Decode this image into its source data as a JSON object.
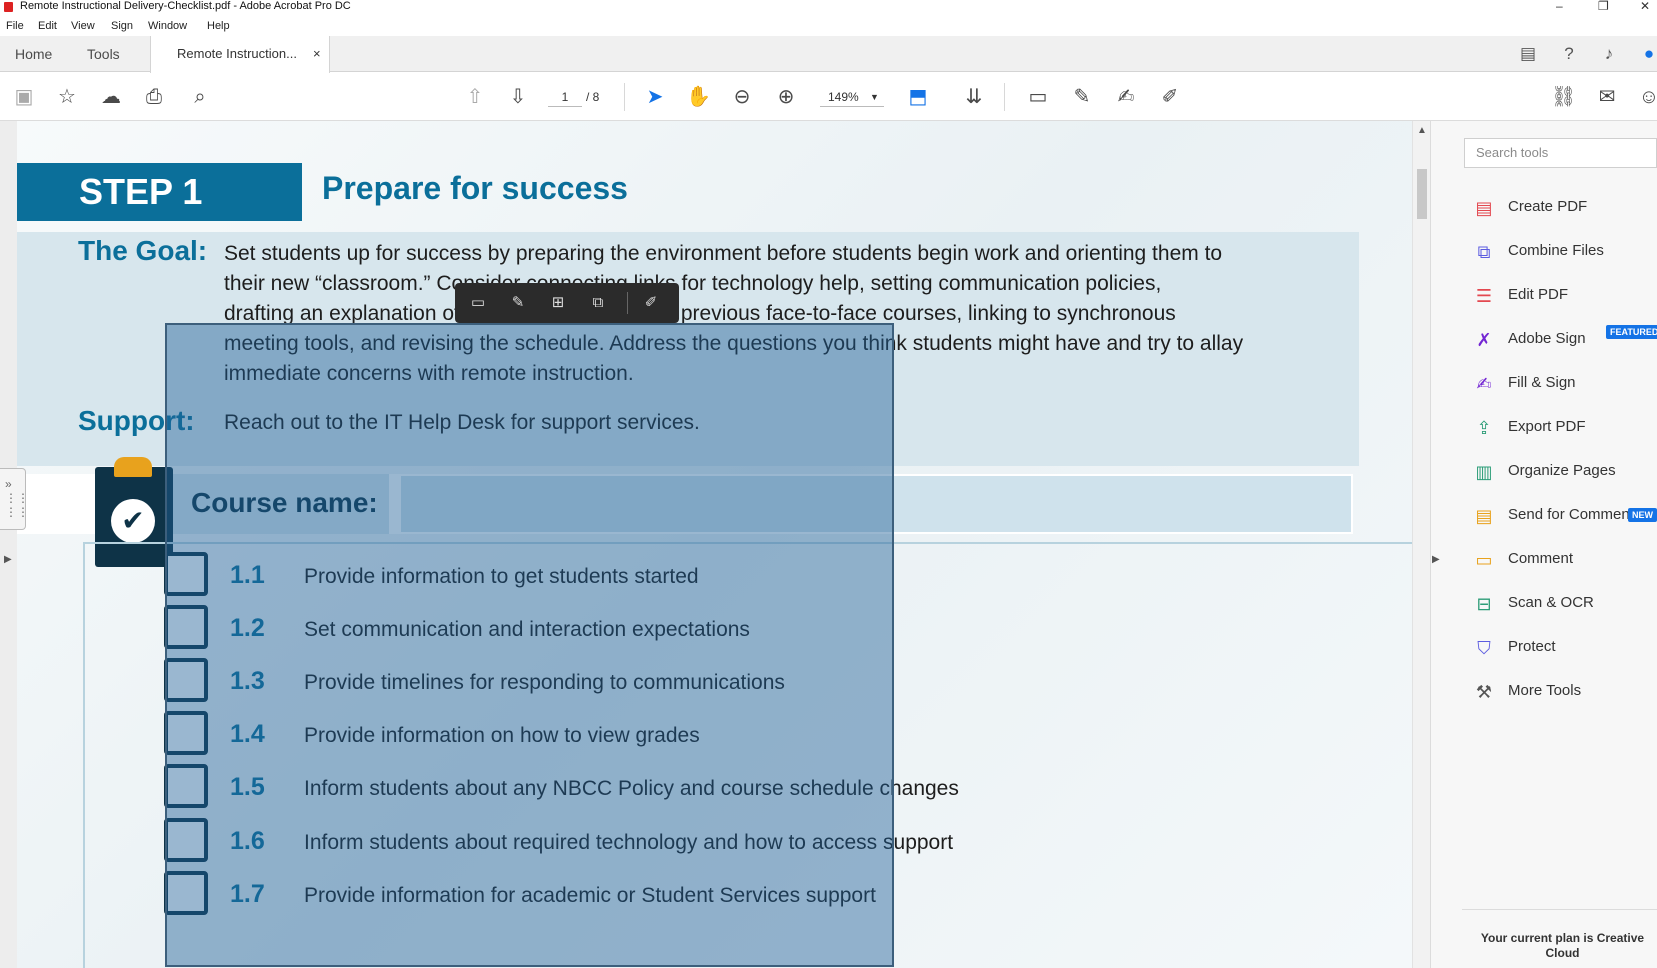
{
  "window": {
    "title": "Remote Instructional Delivery-Checklist.pdf - Adobe Acrobat Pro DC",
    "controls": [
      "minimize-icon",
      "restore-icon",
      "close-icon"
    ]
  },
  "menu": [
    "File",
    "Edit",
    "View",
    "Sign",
    "Window",
    "Help"
  ],
  "tabs": {
    "home": "Home",
    "tools": "Tools",
    "document": "Remote Instruction...",
    "close": "×",
    "right_icons": [
      "chat-icon",
      "help-icon",
      "bell-icon",
      "account-icon"
    ]
  },
  "toolbar": {
    "page_current": "1",
    "page_total": "/ 8",
    "zoom": "149%",
    "left_icons": [
      "save-icon",
      "bookmark-star-icon",
      "upload-icon",
      "print-icon",
      "search-zoom-icon"
    ],
    "nav_icons": [
      "page-up-icon",
      "page-down-icon"
    ],
    "view_icons": [
      "select-arrow-icon",
      "hand-icon",
      "zoom-out-icon",
      "zoom-in-icon"
    ],
    "right_icons": [
      "fit-page-icon",
      "scroll-mode-icon",
      "comment-icon",
      "highlight-icon",
      "sign-icon",
      "edit-icon",
      "link-icon",
      "mail-icon",
      "share-user-icon"
    ]
  },
  "document": {
    "step_label": "STEP 1",
    "step_heading": "Prepare for success",
    "goal_label": "The Goal:",
    "goal_text": [
      "Set students up for success by preparing the environment before students begin work and orienting them to",
      "their new “classroom.” Consider connecting links for technology help, setting communication policies,",
      "drafting an explanation of what’s different than in previous face-to-face courses, linking to synchronous",
      "meeting tools, and revising the schedule.  Address the questions you think students might have and try to allay",
      "immediate concerns with remote instruction."
    ],
    "support_label": "Support:",
    "support_text": "Reach out to the IT Help Desk for support services.",
    "course_label": "Course name:",
    "items": [
      {
        "num": "1.1",
        "text": "Provide information to get students started"
      },
      {
        "num": "1.2",
        "text": "Set communication and interaction expectations"
      },
      {
        "num": "1.3",
        "text": "Provide timelines for responding to communications"
      },
      {
        "num": "1.4",
        "text": "Provide information on how to view grades"
      },
      {
        "num": "1.5",
        "text": "Inform students about any NBCC Policy and course schedule changes"
      },
      {
        "num": "1.6",
        "text": "Inform students about required technology and how to access support"
      },
      {
        "num": "1.7",
        "text": "Provide information for academic or Student Services support"
      }
    ]
  },
  "selection_toolbar": [
    "comment-icon",
    "highlight-pen-icon",
    "stamp-icon",
    "crop-copy-icon",
    "edit-text-icon"
  ],
  "tools_pane": {
    "search_placeholder": "Search tools",
    "items": [
      {
        "label": "Create PDF",
        "icon": "create-pdf-icon",
        "color": "#e34850"
      },
      {
        "label": "Combine Files",
        "icon": "combine-files-icon",
        "color": "#5c5ce0"
      },
      {
        "label": "Edit PDF",
        "icon": "edit-pdf-icon",
        "color": "#e34850"
      },
      {
        "label": "Adobe Sign",
        "icon": "adobe-sign-icon",
        "color": "#7326d3",
        "badge": "FEATURED"
      },
      {
        "label": "Fill & Sign",
        "icon": "fill-sign-icon",
        "color": "#7326d3"
      },
      {
        "label": "Export PDF",
        "icon": "export-pdf-icon",
        "color": "#2d9d78"
      },
      {
        "label": "Organize Pages",
        "icon": "organize-pages-icon",
        "color": "#2d9d78"
      },
      {
        "label": "Send for Comments",
        "icon": "send-comments-icon",
        "color": "#e8a21d",
        "badge": "NEW"
      },
      {
        "label": "Comment",
        "icon": "comment-icon",
        "color": "#e8a21d"
      },
      {
        "label": "Scan & OCR",
        "icon": "scan-ocr-icon",
        "color": "#2d9d78"
      },
      {
        "label": "Protect",
        "icon": "shield-icon",
        "color": "#5c5ce0"
      },
      {
        "label": "More Tools",
        "icon": "more-tools-icon",
        "color": "#555555"
      }
    ],
    "plan_text": "Your current plan is Creative Cloud"
  }
}
